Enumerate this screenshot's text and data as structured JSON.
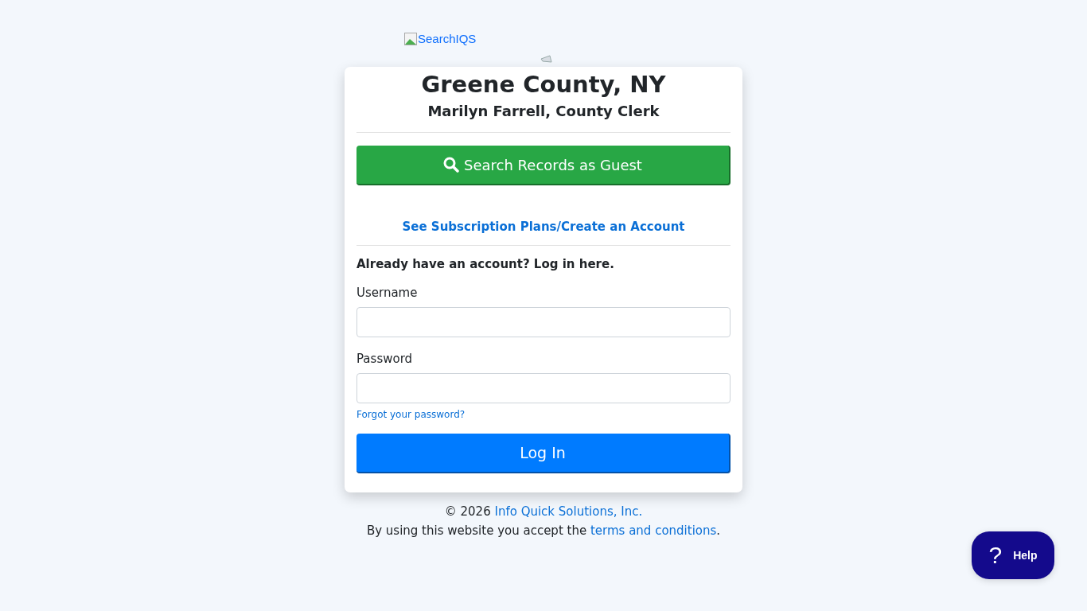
{
  "logo": {
    "alt_text": "SearchIQS"
  },
  "card": {
    "title": "Greene County, NY",
    "subtitle": "Marilyn Farrell, County Clerk",
    "guest_button": "Search Records as Guest",
    "subscription_link": "See Subscription Plans/Create an Account",
    "login_heading": "Already have an account? Log in here.",
    "fields": [
      {
        "label": "Username"
      },
      {
        "label": "Password"
      }
    ],
    "forgot_link": "Forgot your password?",
    "login_button": "Log In"
  },
  "footer": {
    "copyright_prefix": "© 2026",
    "company_link": "Info Quick Solutions, Inc.",
    "terms_prefix": "By using this website you accept the",
    "terms_link": "terms and conditions",
    "terms_suffix": "."
  },
  "help_button": {
    "icon": "?",
    "label": "Help"
  }
}
